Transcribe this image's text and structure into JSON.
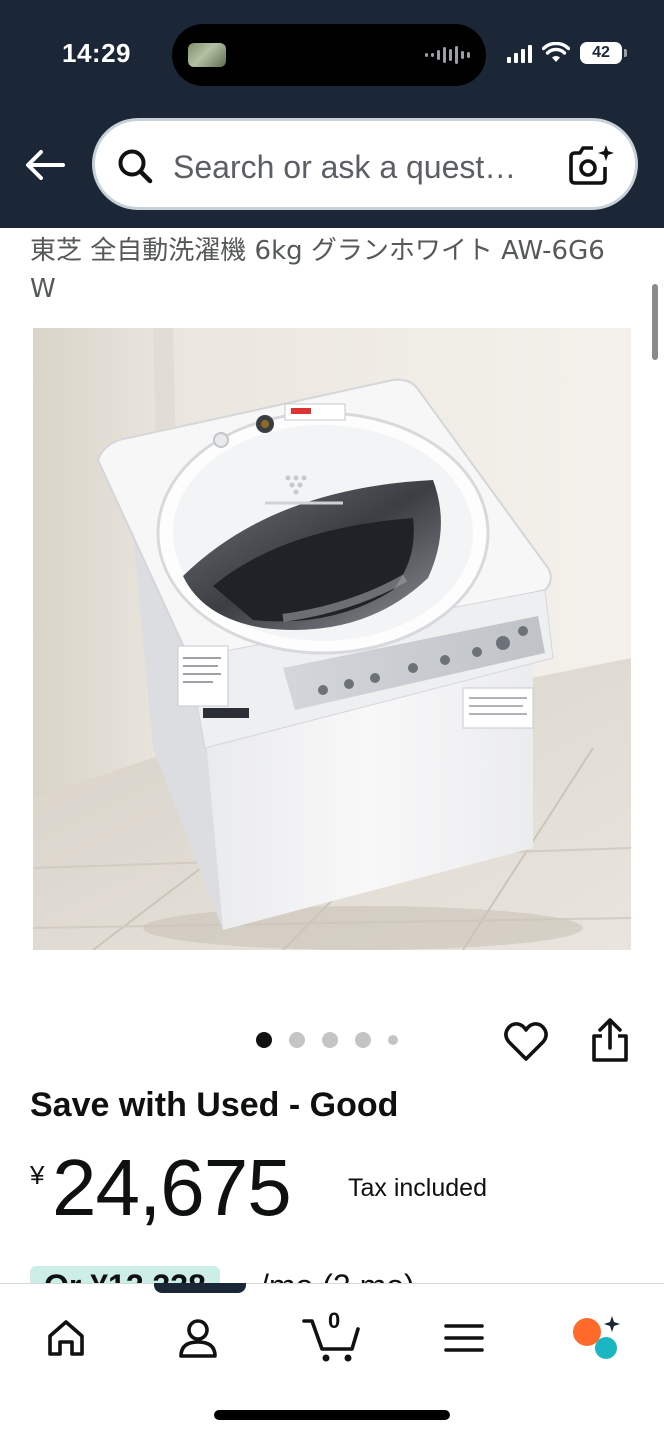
{
  "status_bar": {
    "time": "14:29",
    "battery": "42"
  },
  "search": {
    "placeholder": "Search or ask a quest…"
  },
  "product": {
    "title": "東芝 全自動洗濯機 6kg グランホワイト AW-6G6 W",
    "image_count": 5,
    "active_image": 1,
    "save_label": "Save with Used - Good",
    "currency_symbol": "¥",
    "price": "24,675",
    "tax_note": "Tax included",
    "installment_amount": "Or ¥12,338",
    "installment_term": "/mo (2 mo)"
  },
  "bottom_nav": {
    "items": [
      "home",
      "account",
      "cart",
      "menu",
      "rufus"
    ],
    "cart_count": "0"
  },
  "colors": {
    "header_bg": "#1b2636",
    "rufus_orange": "#ff6a2b",
    "rufus_teal": "#1bb6c1",
    "installment_bg": "#cdeee6"
  }
}
